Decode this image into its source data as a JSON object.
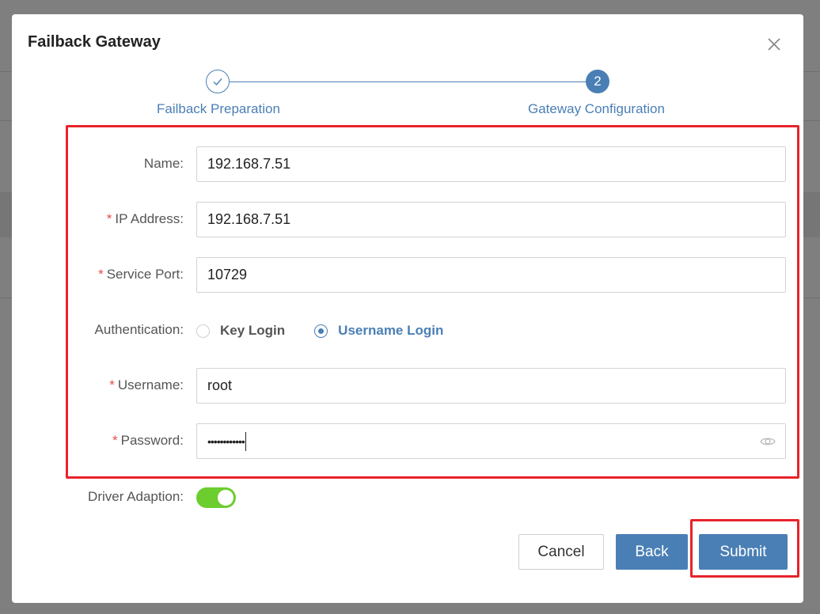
{
  "dialog": {
    "title": "Failback Gateway",
    "steps": [
      {
        "label": "Failback Preparation",
        "state": "completed"
      },
      {
        "number": "2",
        "label": "Gateway Configuration",
        "state": "active"
      }
    ]
  },
  "form": {
    "name": {
      "label": "Name:",
      "value": "192.168.7.51"
    },
    "ip_address": {
      "required_mark": "*",
      "label": "IP Address:",
      "value": "192.168.7.51"
    },
    "service_port": {
      "required_mark": "*",
      "label": "Service Port:",
      "value": "10729"
    },
    "authentication": {
      "label": "Authentication:",
      "options": [
        "Key Login",
        "Username Login"
      ],
      "selected": "Username Login"
    },
    "username": {
      "required_mark": "*",
      "label": "Username:",
      "value": "root"
    },
    "password": {
      "required_mark": "*",
      "label": "Password:",
      "masked_value": "••••••••••••",
      "toggle_icon": "eye-icon"
    },
    "driver_adaption": {
      "label": "Driver Adaption:",
      "enabled": true
    }
  },
  "buttons": {
    "cancel": "Cancel",
    "back": "Back",
    "submit": "Submit"
  },
  "colors": {
    "accent": "#4a7fb5",
    "toggle_on": "#6ccd2e",
    "highlight": "#e8232a",
    "required": "#e84a4a"
  }
}
